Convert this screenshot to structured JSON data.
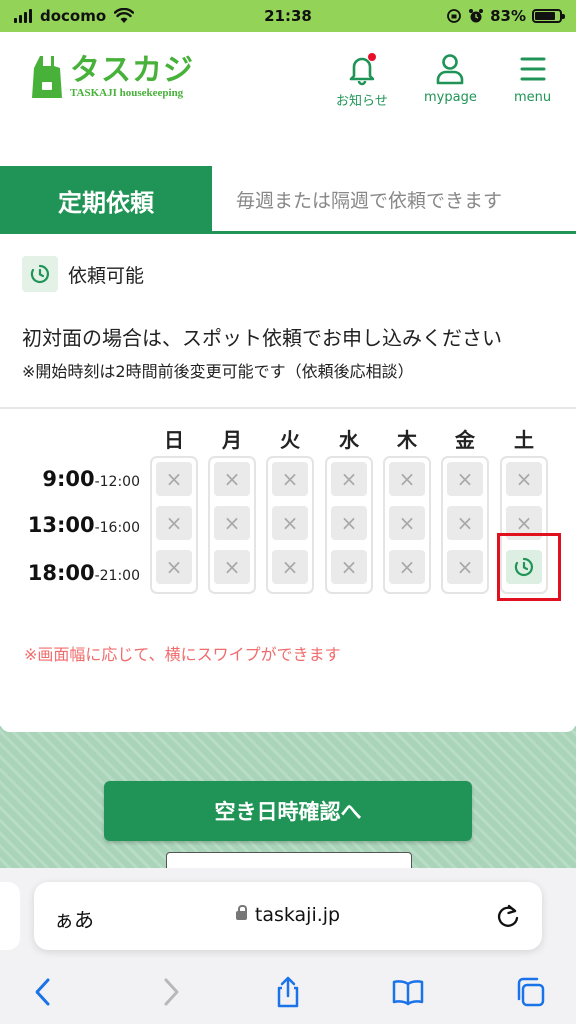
{
  "status_bar": {
    "carrier": "docomo",
    "time": "21:38",
    "battery": "83%",
    "battery_level": 0.83
  },
  "header": {
    "logo_title": "タスカジ",
    "logo_subtitle": "TASKAJI housekeeping",
    "nav": {
      "notifications": "お知らせ",
      "mypage": "mypage",
      "menu": "menu"
    }
  },
  "tabs": {
    "active": "定期依頼",
    "description": "毎週または隔週で依頼できます"
  },
  "section": {
    "available_label": "依頼可能",
    "note1": "初対面の場合は、スポット依頼でお申し込みください",
    "note2": "※開始時刻は2時間前後変更可能です（依頼後応相談）"
  },
  "schedule": {
    "days": [
      "日",
      "月",
      "火",
      "水",
      "木",
      "金",
      "土"
    ],
    "slots": [
      {
        "start": "9:00",
        "end": "-12:00"
      },
      {
        "start": "13:00",
        "end": "-16:00"
      },
      {
        "start": "18:00",
        "end": "-21:00"
      }
    ],
    "unavailable_mark": "×",
    "availability": [
      [
        false,
        false,
        false,
        false,
        false,
        false,
        false
      ],
      [
        false,
        false,
        false,
        false,
        false,
        false,
        false
      ],
      [
        false,
        false,
        false,
        false,
        false,
        false,
        true
      ]
    ]
  },
  "swipe_note": "※画面幅に応じて、横にスワイプができます",
  "cta": {
    "label": "空き日時確認へ"
  },
  "browser": {
    "aa_label": "ぁあ",
    "url": "taskaji.jp"
  },
  "colors": {
    "brand_green": "#1f9456",
    "logo_green": "#48b13a",
    "status_green": "#93d458",
    "highlight_red": "#e0101e",
    "note_red": "#f06c6c"
  }
}
